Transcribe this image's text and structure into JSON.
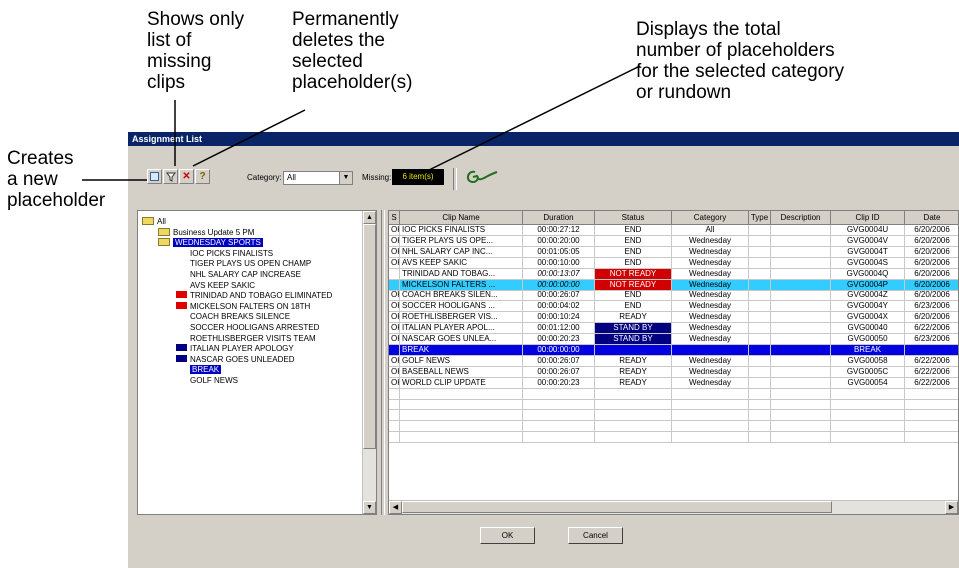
{
  "callouts": {
    "shows_missing": "Shows only\nlist of\nmissing\nclips",
    "deletes": "Permanently\ndeletes the\nselected\nplaceholder(s)",
    "total": "Displays the total\nnumber of placeholders\nfor the selected category\nor rundown",
    "creates": "Creates\na new\nplaceholder"
  },
  "window": {
    "title": "Assignment List"
  },
  "toolbar": {
    "buttons": [
      {
        "icon": "new-placeholder-icon"
      },
      {
        "icon": "filter-icon"
      },
      {
        "icon": "delete-icon"
      },
      {
        "icon": "help-icon"
      }
    ],
    "category_label": "Category:",
    "category_value": "All",
    "missing_label": "Missing:",
    "missing_value": "6 item(s)",
    "colors": {
      "missing_bg": "#000000",
      "missing_text": "#e8e800"
    }
  },
  "tree": [
    {
      "label": "All",
      "level": 0,
      "folder": true
    },
    {
      "label": "Business Update 5 PM",
      "level": 1,
      "folder": true
    },
    {
      "label": "WEDNESDAY SPORTS",
      "level": 1,
      "folder": true,
      "selected": true
    },
    {
      "label": "IOC PICKS FINALISTS",
      "level": 2
    },
    {
      "label": "TIGER PLAYS US OPEN CHAMP",
      "level": 2
    },
    {
      "label": "NHL SALARY CAP INCREASE",
      "level": 2
    },
    {
      "label": "AVS KEEP SAKIC",
      "level": 2
    },
    {
      "label": "TRINIDAD AND TOBAGO ELIMINATED",
      "level": 2,
      "mark": "#e00000"
    },
    {
      "label": "MICKELSON FALTERS ON 18TH",
      "level": 2,
      "mark": "#e00000"
    },
    {
      "label": "COACH BREAKS SILENCE",
      "level": 2
    },
    {
      "label": "SOCCER HOOLIGANS ARRESTED",
      "level": 2
    },
    {
      "label": "ROETHLISBERGER VISITS TEAM",
      "level": 2
    },
    {
      "label": "ITALIAN PLAYER APOLOGY",
      "level": 2,
      "mark": "#000080"
    },
    {
      "label": "NASCAR GOES UNLEADED",
      "level": 2,
      "mark": "#000080"
    },
    {
      "label": "BREAK",
      "level": 2,
      "selected": true
    },
    {
      "label": "GOLF NEWS",
      "level": 2
    }
  ],
  "grid": {
    "headers": [
      "S",
      "Clip Name",
      "Duration",
      "Status",
      "Category",
      "Type",
      "Description",
      "Clip ID",
      "Date"
    ],
    "rows": [
      {
        "cells": [
          "OK",
          "IOC PICKS FINALISTS",
          "00:00:27:12",
          "END",
          "All",
          "",
          "",
          "GVG0004U",
          "6/20/2006"
        ]
      },
      {
        "cells": [
          "OK",
          "TIGER PLAYS US OPE...",
          "00:00:20:00",
          "END",
          "Wednesday",
          "",
          "",
          "GVG0004V",
          "6/20/2006"
        ]
      },
      {
        "cells": [
          "OK",
          "NHL SALARY CAP INC...",
          "00:01:05:05",
          "END",
          "Wednesday",
          "",
          "",
          "GVG0004T",
          "6/20/2006"
        ]
      },
      {
        "cells": [
          "OK",
          "AVS KEEP SAKIC",
          "00:00:10:00",
          "END",
          "Wednesday",
          "",
          "",
          "GVG0004S",
          "6/20/2006"
        ]
      },
      {
        "cells": [
          "",
          "TRINIDAD AND TOBAG...",
          "00:00:13:07",
          "NOT READY",
          "Wednesday",
          "",
          "",
          "GVG0004Q",
          "6/20/2006"
        ],
        "status_bg": "#d00000",
        "status_fg": "#ffffff",
        "italic_duration": true
      },
      {
        "cells": [
          "",
          "MICKELSON FALTERS ...",
          "00:00:00:00",
          "NOT READY",
          "Wednesday",
          "",
          "",
          "GVG0004P",
          "6/20/2006"
        ],
        "row_bg": "#33ccff",
        "status_bg": "#d00000",
        "status_fg": "#ffffff",
        "italic_duration": true
      },
      {
        "cells": [
          "OK",
          "COACH BREAKS SILEN...",
          "00:00:26:07",
          "END",
          "Wednesday",
          "",
          "",
          "GVG0004Z",
          "6/20/2006"
        ]
      },
      {
        "cells": [
          "OK",
          "SOCCER HOOLIGANS ...",
          "00:00:04:02",
          "END",
          "Wednesday",
          "",
          "",
          "GVG0004Y",
          "6/23/2006"
        ]
      },
      {
        "cells": [
          "OK",
          "ROETHLISBERGER VIS...",
          "00:00:10:24",
          "READY",
          "Wednesday",
          "",
          "",
          "GVG0004X",
          "6/20/2006"
        ]
      },
      {
        "cells": [
          "OK",
          "ITALIAN PLAYER APOL...",
          "00:01:12:00",
          "STAND BY",
          "Wednesday",
          "",
          "",
          "GVG00040",
          "6/22/2006"
        ],
        "status_bg": "#000080",
        "status_fg": "#ffffff"
      },
      {
        "cells": [
          "OK",
          "NASCAR GOES UNLEA...",
          "00:00:20:23",
          "STAND BY",
          "Wednesday",
          "",
          "",
          "GVG00050",
          "6/23/2006"
        ],
        "status_bg": "#000080",
        "status_fg": "#ffffff"
      },
      {
        "cells": [
          "",
          "BREAK",
          "00:00:00:00",
          "",
          "",
          "",
          "",
          "BREAK",
          ""
        ],
        "row_bg": "#0000e0",
        "row_fg": "#ffffff"
      },
      {
        "cells": [
          "OK",
          "GOLF NEWS",
          "00:00:26:07",
          "READY",
          "Wednesday",
          "",
          "",
          "GVG00058",
          "6/22/2006"
        ]
      },
      {
        "cells": [
          "OK",
          "BASEBALL NEWS",
          "00:00:26:07",
          "READY",
          "Wednesday",
          "",
          "",
          "GVG0005C",
          "6/22/2006"
        ]
      },
      {
        "cells": [
          "OK",
          "WORLD CLIP UPDATE",
          "00:00:20:23",
          "READY",
          "Wednesday",
          "",
          "",
          "GVG00054",
          "6/22/2006"
        ]
      }
    ],
    "empty_rows": 5
  },
  "buttons": {
    "ok": "OK",
    "cancel": "Cancel"
  }
}
